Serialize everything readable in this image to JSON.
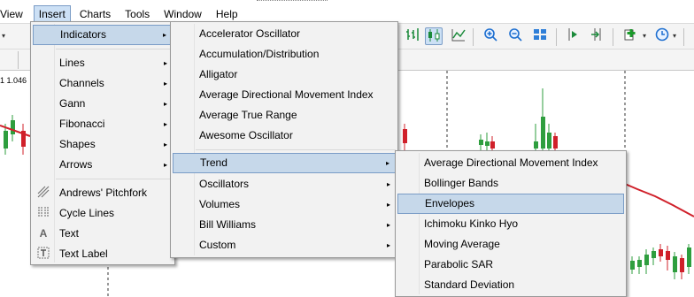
{
  "menubar": {
    "items": [
      "View",
      "Insert",
      "Charts",
      "Tools",
      "Window",
      "Help"
    ],
    "active": "Insert"
  },
  "chart": {
    "symbol_label": "1  1.046"
  },
  "insert_menu": {
    "items": [
      {
        "label": "Indicators",
        "submenu": true
      },
      {
        "label": "Lines",
        "submenu": true
      },
      {
        "label": "Channels",
        "submenu": true
      },
      {
        "label": "Gann",
        "submenu": true
      },
      {
        "label": "Fibonacci",
        "submenu": true
      },
      {
        "label": "Shapes",
        "submenu": true
      },
      {
        "label": "Arrows",
        "submenu": true
      },
      {
        "label": "Andrews' Pitchfork",
        "icon": "pitchfork-icon"
      },
      {
        "label": "Cycle Lines",
        "icon": "cycle-lines-icon"
      },
      {
        "label": "Text",
        "icon": "text-icon"
      },
      {
        "label": "Text Label",
        "icon": "text-label-icon"
      }
    ]
  },
  "indicators_menu": {
    "items": [
      {
        "label": "Accelerator Oscillator"
      },
      {
        "label": "Accumulation/Distribution"
      },
      {
        "label": "Alligator"
      },
      {
        "label": "Average Directional Movement Index"
      },
      {
        "label": "Average True Range"
      },
      {
        "label": "Awesome Oscillator"
      },
      {
        "label": "Trend",
        "submenu": true
      },
      {
        "label": "Oscillators",
        "submenu": true
      },
      {
        "label": "Volumes",
        "submenu": true
      },
      {
        "label": "Bill Williams",
        "submenu": true
      },
      {
        "label": "Custom",
        "submenu": true
      }
    ]
  },
  "trend_menu": {
    "items": [
      {
        "label": "Average Directional Movement Index"
      },
      {
        "label": "Bollinger Bands"
      },
      {
        "label": "Envelopes"
      },
      {
        "label": "Ichimoku Kinko Hyo"
      },
      {
        "label": "Moving Average"
      },
      {
        "label": "Parabolic SAR"
      },
      {
        "label": "Standard Deviation"
      }
    ]
  },
  "arrow_glyph": "▸",
  "colors": {
    "bull_candle": "#2e9e3e",
    "bear_candle": "#d0202a",
    "ma_line": "#d0202a",
    "menu_highlight": "#c6d8ea"
  }
}
